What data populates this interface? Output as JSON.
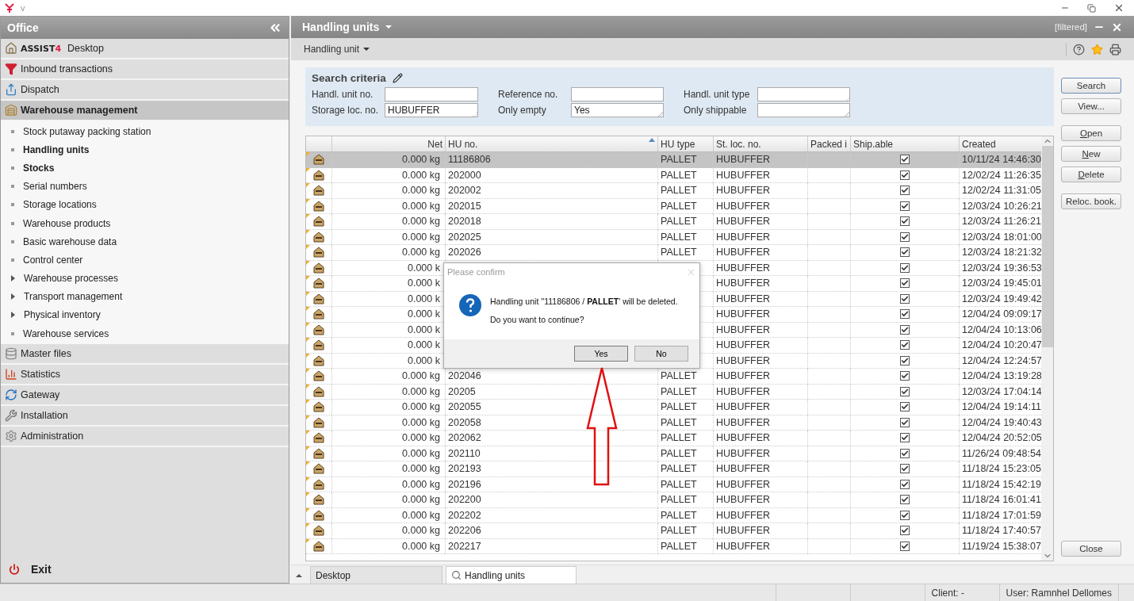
{
  "app_bar": {
    "title": "v"
  },
  "sidebar": {
    "title": "Office",
    "sections": [
      {
        "logo": "ASSIST",
        "logo_accent": "4",
        "label": "Desktop",
        "expanded": false
      },
      {
        "label": "Inbound transactions",
        "expanded": false
      },
      {
        "label": "Dispatch",
        "expanded": false
      },
      {
        "label": "Warehouse management",
        "expanded": true,
        "children": [
          {
            "label": "Stock putaway packing station",
            "kind": "item",
            "emphasized": false
          },
          {
            "label": "Handling units",
            "kind": "item",
            "emphasized": true
          },
          {
            "label": "Stocks",
            "kind": "item",
            "emphasized": true
          },
          {
            "label": "Serial numbers",
            "kind": "item",
            "emphasized": false
          },
          {
            "label": "Storage locations",
            "kind": "item",
            "emphasized": false
          },
          {
            "label": "Warehouse products",
            "kind": "item",
            "emphasized": false
          },
          {
            "label": "Basic warehouse data",
            "kind": "item",
            "emphasized": false
          },
          {
            "label": "Control center",
            "kind": "item",
            "emphasized": false
          },
          {
            "label": "Warehouse processes",
            "kind": "group",
            "emphasized": false
          },
          {
            "label": "Transport management",
            "kind": "group",
            "emphasized": false
          },
          {
            "label": "Physical inventory",
            "kind": "group",
            "emphasized": false
          },
          {
            "label": "Warehouse services",
            "kind": "item",
            "emphasized": false
          }
        ]
      },
      {
        "label": "Master files",
        "expanded": false
      },
      {
        "label": "Statistics",
        "expanded": false
      },
      {
        "label": "Gateway",
        "expanded": false
      },
      {
        "label": "Installation",
        "expanded": false
      },
      {
        "label": "Administration",
        "expanded": false
      }
    ],
    "exit": "Exit"
  },
  "module": {
    "title": "Handling units",
    "filter_tag": "[filtered]",
    "menu": "Handling unit"
  },
  "search_criteria": {
    "title": "Search criteria",
    "fields": [
      {
        "label": "Handl. unit no.",
        "kind": "text"
      },
      {
        "label": "Reference no.",
        "kind": "text"
      },
      {
        "label": "Handl. unit type",
        "kind": "combo"
      },
      {
        "label": "Storage loc. no.",
        "value": "HUBUFFER",
        "kind": "combo"
      },
      {
        "label": "Only empty",
        "value": "Yes",
        "kind": "combo"
      },
      {
        "label": "Only shippable",
        "kind": "combo"
      }
    ]
  },
  "query_buttons": [
    {
      "label": "Search",
      "focused": true,
      "mnemonic": false
    },
    {
      "label": "View...",
      "focused": false,
      "mnemonic": false
    }
  ],
  "record_buttons": [
    {
      "label": "Open",
      "focused": false,
      "mnemonic": true
    },
    {
      "label": "New",
      "focused": false,
      "mnemonic": true
    },
    {
      "label": "Delete",
      "focused": false,
      "mnemonic": true
    }
  ],
  "extra_buttons": [
    {
      "label": "Reloc. book.",
      "focused": false,
      "mnemonic": false
    }
  ],
  "close_button": {
    "label": "Close",
    "focused": false,
    "mnemonic": false
  },
  "table": {
    "columns": [
      {
        "label": "Net",
        "sorted": false
      },
      {
        "label": "HU no.",
        "sorted": true
      },
      {
        "label": "HU type",
        "sorted": false
      },
      {
        "label": "St. loc. no.",
        "sorted": false
      },
      {
        "label": "Packed i",
        "sorted": false
      },
      {
        "label": "Ship.able",
        "sorted": false
      },
      {
        "label": "Created",
        "sorted": false
      }
    ],
    "rows": [
      {
        "net": "0.000 kg",
        "hu_no": "11186806",
        "hu_type": "PALLET",
        "location": "HUBUFFER",
        "shippable": true,
        "created": "10/11/24 14:46:30",
        "selected": true
      },
      {
        "net": "0.000 kg",
        "hu_no": "202000",
        "hu_type": "PALLET",
        "location": "HUBUFFER",
        "shippable": true,
        "created": "12/02/24 11:26:35",
        "selected": false
      },
      {
        "net": "0.000 kg",
        "hu_no": "202002",
        "hu_type": "PALLET",
        "location": "HUBUFFER",
        "shippable": true,
        "created": "12/02/24 11:31:05",
        "selected": false
      },
      {
        "net": "0.000 kg",
        "hu_no": "202015",
        "hu_type": "PALLET",
        "location": "HUBUFFER",
        "shippable": true,
        "created": "12/03/24 10:26:21",
        "selected": false
      },
      {
        "net": "0.000 kg",
        "hu_no": "202018",
        "hu_type": "PALLET",
        "location": "HUBUFFER",
        "shippable": true,
        "created": "12/03/24 11:26:21",
        "selected": false
      },
      {
        "net": "0.000 kg",
        "hu_no": "202025",
        "hu_type": "PALLET",
        "location": "HUBUFFER",
        "shippable": true,
        "created": "12/03/24 18:01:00",
        "selected": false
      },
      {
        "net": "0.000 kg",
        "hu_no": "202026",
        "hu_type": "PALLET",
        "location": "HUBUFFER",
        "shippable": true,
        "created": "12/03/24 18:21:32",
        "selected": false
      },
      {
        "net": "0.000 k",
        "location": "HUBUFFER",
        "shippable": true,
        "created": "12/03/24 19:36:53",
        "selected": false
      },
      {
        "net": "0.000 k",
        "location": "HUBUFFER",
        "shippable": true,
        "created": "12/03/24 19:45:01",
        "selected": false
      },
      {
        "net": "0.000 k",
        "location": "HUBUFFER",
        "shippable": true,
        "created": "12/03/24 19:49:42",
        "selected": false
      },
      {
        "net": "0.000 k",
        "location": "HUBUFFER",
        "shippable": true,
        "created": "12/04/24 09:09:17",
        "selected": false
      },
      {
        "net": "0.000 k",
        "location": "HUBUFFER",
        "shippable": true,
        "created": "12/04/24 10:13:06",
        "selected": false
      },
      {
        "net": "0.000 k",
        "location": "HUBUFFER",
        "shippable": true,
        "created": "12/04/24 10:20:47",
        "selected": false
      },
      {
        "net": "0.000 k",
        "location": "HUBUFFER",
        "shippable": true,
        "created": "12/04/24 12:24:57",
        "selected": false
      },
      {
        "net": "0.000 kg",
        "hu_no": "202046",
        "hu_type": "PALLET",
        "location": "HUBUFFER",
        "shippable": true,
        "created": "12/04/24 13:19:28",
        "selected": false
      },
      {
        "net": "0.000 kg",
        "hu_no": "20205",
        "hu_type": "PALLET",
        "location": "HUBUFFER",
        "shippable": true,
        "created": "12/03/24 17:04:14",
        "selected": false
      },
      {
        "net": "0.000 kg",
        "hu_no": "202055",
        "hu_type": "PALLET",
        "location": "HUBUFFER",
        "shippable": true,
        "created": "12/04/24 19:14:11",
        "selected": false
      },
      {
        "net": "0.000 kg",
        "hu_no": "202058",
        "hu_type": "PALLET",
        "location": "HUBUFFER",
        "shippable": true,
        "created": "12/04/24 19:40:43",
        "selected": false
      },
      {
        "net": "0.000 kg",
        "hu_no": "202062",
        "hu_type": "PALLET",
        "location": "HUBUFFER",
        "shippable": true,
        "created": "12/04/24 20:52:05",
        "selected": false
      },
      {
        "net": "0.000 kg",
        "hu_no": "202110",
        "hu_type": "PALLET",
        "location": "HUBUFFER",
        "shippable": true,
        "created": "11/26/24 09:48:54",
        "selected": false
      },
      {
        "net": "0.000 kg",
        "hu_no": "202193",
        "hu_type": "PALLET",
        "location": "HUBUFFER",
        "shippable": true,
        "created": "11/18/24 15:23:05",
        "selected": false
      },
      {
        "net": "0.000 kg",
        "hu_no": "202196",
        "hu_type": "PALLET",
        "location": "HUBUFFER",
        "shippable": true,
        "created": "11/18/24 15:42:19",
        "selected": false
      },
      {
        "net": "0.000 kg",
        "hu_no": "202200",
        "hu_type": "PALLET",
        "location": "HUBUFFER",
        "shippable": true,
        "created": "11/18/24 16:01:41",
        "selected": false
      },
      {
        "net": "0.000 kg",
        "hu_no": "202202",
        "hu_type": "PALLET",
        "location": "HUBUFFER",
        "shippable": true,
        "created": "11/18/24 17:01:59",
        "selected": false
      },
      {
        "net": "0.000 kg",
        "hu_no": "202206",
        "hu_type": "PALLET",
        "location": "HUBUFFER",
        "shippable": true,
        "created": "11/18/24 17:40:57",
        "selected": false
      },
      {
        "net": "0.000 kg",
        "hu_no": "202217",
        "hu_type": "PALLET",
        "location": "HUBUFFER",
        "shippable": true,
        "created": "11/19/24 15:38:07",
        "selected": false
      }
    ]
  },
  "dialog": {
    "title": "Please confirm",
    "message": "Handling unit ''11186806 / **PALLET**' will be deleted.",
    "question": "Do you want to continue?",
    "buttons": [
      {
        "label": "Yes",
        "selected": true
      },
      {
        "label": "No",
        "selected": false
      }
    ]
  },
  "tabs": [
    {
      "label": "Desktop",
      "selected": false
    },
    {
      "label": "Handling units",
      "selected": true
    }
  ],
  "status_bar": {
    "client": "Client: -",
    "user": "User: Ramnhel Dellomes"
  }
}
